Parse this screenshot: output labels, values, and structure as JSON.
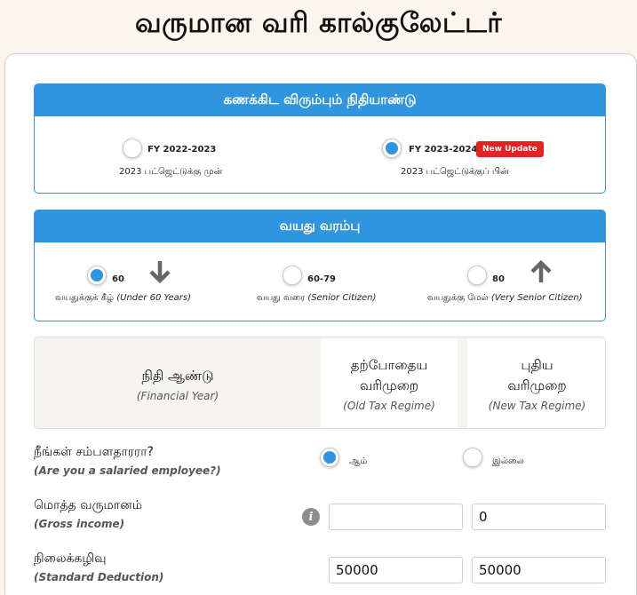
{
  "title": "வருமான வரி கால்குலேட்டர்",
  "fy_panel": {
    "heading": "கணக்கிட விரும்பும் நிதியாண்டு",
    "options": [
      {
        "label": "FY 2022-2023",
        "sub": "2023 பட்ஜெட்டுக்கு முன்",
        "selected": false
      },
      {
        "label": "FY 2023-2024",
        "sub": "2023 பட்ஜெட்டுக்குப் பின்",
        "selected": true,
        "badge": "New Update"
      }
    ]
  },
  "age_panel": {
    "heading": "வயது வரம்பு",
    "options": [
      {
        "label": "60",
        "sub_ta": "வயதுக்குக் கீழ்",
        "sub_en": "(Under 60 Years)",
        "selected": true,
        "icon": "arrow-down-icon"
      },
      {
        "label": "60-79",
        "sub_ta": "வயது வரை",
        "sub_en": "(Senior Citizen)",
        "selected": false
      },
      {
        "label": "80",
        "sub_ta": "வயதுக்கு மேல்",
        "sub_en": "(Very Senior Citizen)",
        "selected": false,
        "icon": "arrow-up-icon"
      }
    ]
  },
  "table_header": {
    "col1_ta": "நிதி ஆண்டு",
    "col1_en": "(Financial Year)",
    "col2_ta_line1": "தற்போதைய",
    "col2_ta_line2": "வரிமுறை",
    "col2_en": "(Old Tax Regime)",
    "col3_ta_line1": "புதிய",
    "col3_ta_line2": "வரிமுறை",
    "col3_en": "(New Tax Regime)"
  },
  "salaried": {
    "label_ta": "நீங்கள் சம்பளதாரரா?",
    "label_en": "(Are you a salaried employee?)",
    "yes": "ஆம்",
    "no": "இல்லை",
    "selected": "yes"
  },
  "gross_income": {
    "label_ta": "மொத்த வருமானம்",
    "label_en": "(Gross income)",
    "old_value": "",
    "new_value": "0"
  },
  "standard_deduction": {
    "label_ta": "நிலைக்கழிவு",
    "label_en": "(Standard Deduction)",
    "old_value": "50000",
    "new_value": "50000"
  },
  "colors": {
    "accent": "#2f95e0",
    "badge": "#e52222"
  }
}
